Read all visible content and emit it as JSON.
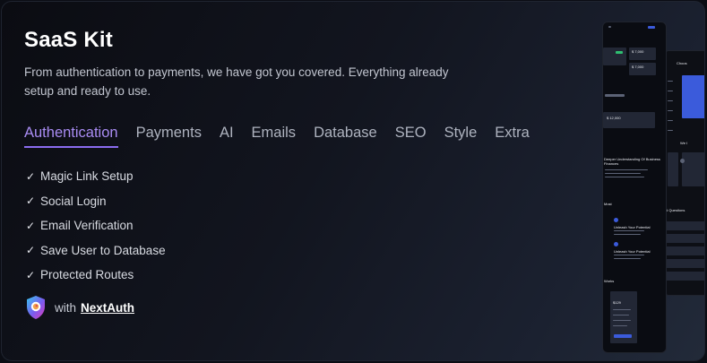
{
  "header": {
    "title": "SaaS Kit",
    "subtitle": "From authentication to payments, we have got you covered. Everything already setup and ready to use."
  },
  "tabs": [
    {
      "label": "Authentication",
      "active": true
    },
    {
      "label": "Payments",
      "active": false
    },
    {
      "label": "AI",
      "active": false
    },
    {
      "label": "Emails",
      "active": false
    },
    {
      "label": "Database",
      "active": false
    },
    {
      "label": "SEO",
      "active": false
    },
    {
      "label": "Style",
      "active": false
    },
    {
      "label": "Extra",
      "active": false
    }
  ],
  "features": [
    {
      "icon": "check-icon",
      "check": "✓",
      "label": "Magic Link Setup"
    },
    {
      "icon": "check-icon",
      "check": "✓",
      "label": "Social Login"
    },
    {
      "icon": "check-icon",
      "check": "✓",
      "label": "Email Verification"
    },
    {
      "icon": "check-icon",
      "check": "✓",
      "label": "Save User to Database"
    },
    {
      "icon": "check-icon",
      "check": "✓",
      "label": "Protected Routes"
    }
  ],
  "powered_by": {
    "icon": "nextauth-shield-icon",
    "prefix": "with",
    "link": "NextAuth"
  },
  "preview": {
    "front_heading": "Deeper Understanding Of Business Finances",
    "front_section": "Most",
    "front_item_1": "Unleash Your Potential",
    "front_item_2": "Unleash Your Potential",
    "front_value_1": "$ 7,000",
    "front_value_2": "$ 7,000",
    "front_value_3": "$ 12,000",
    "front_footer": "Works",
    "front_price": "$129",
    "back_heading": "Choos",
    "back_item": "We I",
    "back_faq": "d Questions"
  },
  "colors": {
    "accent": "#8b6cf0",
    "accent_text": "#a98cf3",
    "card_bg_start": "#0b0c12",
    "card_bg_end": "#222a39"
  }
}
